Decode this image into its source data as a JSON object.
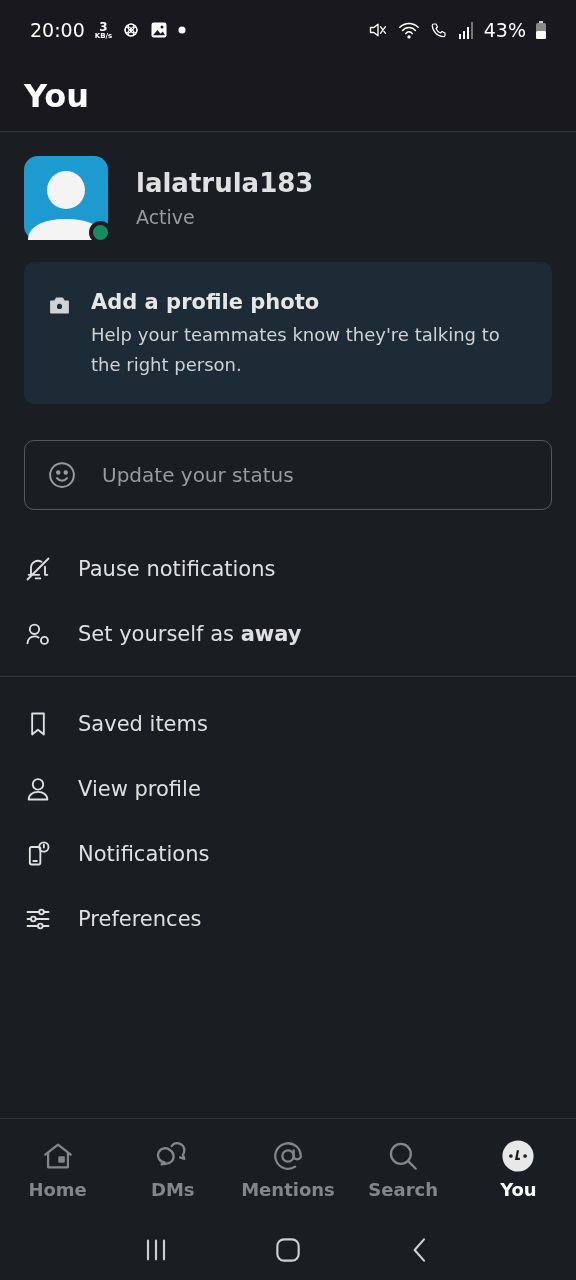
{
  "status_bar": {
    "time": "20:00",
    "speed_value": "3",
    "speed_unit": "KB/s",
    "battery": "43%"
  },
  "header": {
    "title": "You"
  },
  "profile": {
    "username": "lalatrula183",
    "status": "Active",
    "online": true
  },
  "photo_card": {
    "title": "Add a profile photo",
    "text": "Help your teammates know they're talking to the right person."
  },
  "status_field": {
    "placeholder": "Update your status"
  },
  "menu_groups": [
    {
      "items": [
        {
          "label": "Pause notifications"
        },
        {
          "label": "Set yourself as **away**"
        }
      ]
    },
    {
      "items": [
        {
          "label": "Saved items"
        },
        {
          "label": "View profile"
        },
        {
          "label": "Notifications"
        },
        {
          "label": "Preferences"
        }
      ]
    }
  ],
  "bottom_nav": [
    {
      "label": "Home",
      "selected": false
    },
    {
      "label": "DMs",
      "selected": false
    },
    {
      "label": "Mentions",
      "selected": false
    },
    {
      "label": "Search",
      "selected": false
    },
    {
      "label": "You",
      "selected": true
    }
  ]
}
